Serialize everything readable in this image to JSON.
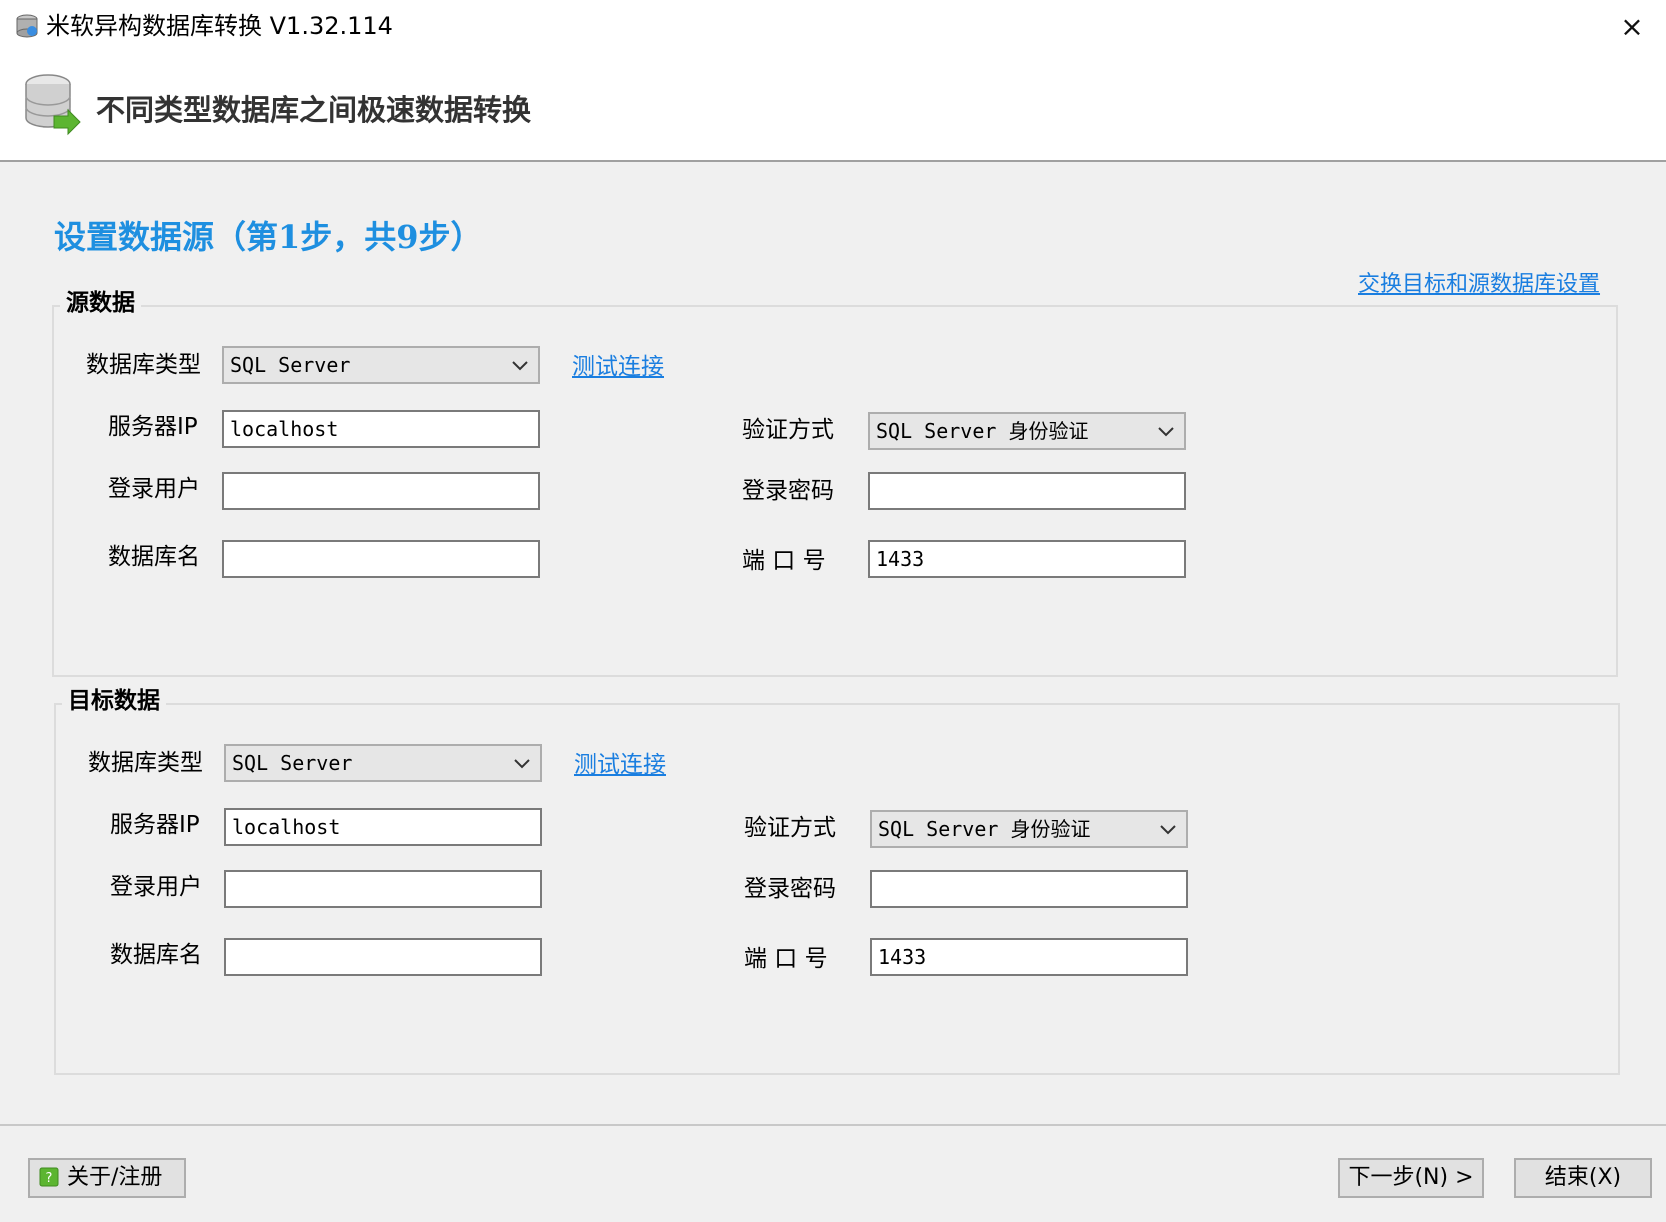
{
  "window": {
    "title": "米软异构数据库转换 V1.32.114",
    "close_icon": "×"
  },
  "header": {
    "title": "不同类型数据库之间极速数据转换"
  },
  "step": {
    "title": "设置数据源（第1步，共9步）",
    "swap_link": "交换目标和源数据库设置"
  },
  "source": {
    "group_title": "源数据",
    "db_type_label": "数据库类型",
    "db_type_value": "SQL Server",
    "test_link": "测试连接",
    "server_ip_label": "服务器IP",
    "server_ip_value": "localhost",
    "auth_label": "验证方式",
    "auth_value": "SQL Server 身份验证",
    "user_label": "登录用户",
    "user_value": "",
    "password_label": "登录密码",
    "password_value": "",
    "dbname_label": "数据库名",
    "dbname_value": "",
    "port_label": "端 口 号",
    "port_value": "1433"
  },
  "target": {
    "group_title": "目标数据",
    "db_type_label": "数据库类型",
    "db_type_value": "SQL Server",
    "test_link": "测试连接",
    "server_ip_label": "服务器IP",
    "server_ip_value": "localhost",
    "auth_label": "验证方式",
    "auth_value": "SQL Server 身份验证",
    "user_label": "登录用户",
    "user_value": "",
    "password_label": "登录密码",
    "password_value": "",
    "dbname_label": "数据库名",
    "dbname_value": "",
    "port_label": "端 口 号",
    "port_value": "1433"
  },
  "footer": {
    "about_label": "关于/注册",
    "next_label": "下一步(N) >",
    "finish_label": "结束(X)"
  },
  "colors": {
    "accent": "#1e8fe0",
    "link": "#1a7ee0"
  }
}
